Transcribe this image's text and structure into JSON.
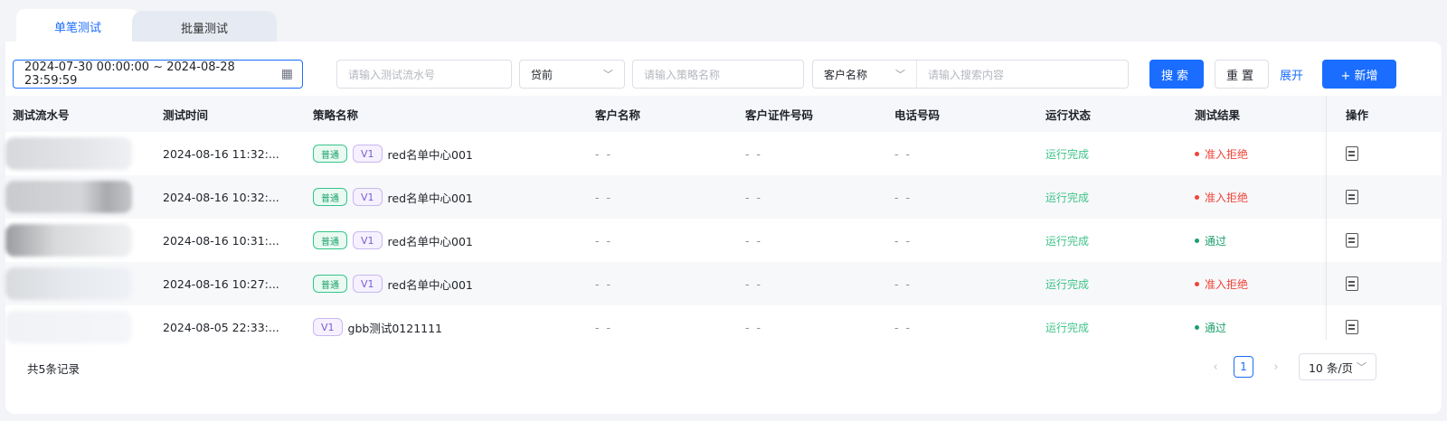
{
  "tabs": [
    {
      "label": "单笔测试",
      "active": true
    },
    {
      "label": "批量测试",
      "active": false
    }
  ],
  "filters": {
    "date_range": "2024-07-30 00:00:00 ~ 2024-08-28 23:59:59",
    "serial_placeholder": "请输入测试流水号",
    "loan_stage": "贷前",
    "strategy_placeholder": "请输入策略名称",
    "search_field": "客户名称",
    "search_placeholder": "请输入搜索内容"
  },
  "buttons": {
    "search": "搜索",
    "reset": "重置",
    "expand": "展开",
    "add": "+ 新增"
  },
  "table": {
    "headers": [
      "测试流水号",
      "测试时间",
      "策略名称",
      "客户名称",
      "客户证件号码",
      "电话号码",
      "运行状态",
      "测试结果",
      "操作"
    ],
    "rows": [
      {
        "time": "2024-08-16 11:32:...",
        "tag": "普通",
        "version": "V1",
        "strategy": "red名单中心001",
        "customer": "- -",
        "id_no": "- -",
        "phone": "- -",
        "status": "运行完成",
        "result": "准入拒绝",
        "result_color": "#f04438"
      },
      {
        "time": "2024-08-16 10:32:...",
        "tag": "普通",
        "version": "V1",
        "strategy": "red名单中心001",
        "customer": "- -",
        "id_no": "- -",
        "phone": "- -",
        "status": "运行完成",
        "result": "准入拒绝",
        "result_color": "#f04438"
      },
      {
        "time": "2024-08-16 10:31:...",
        "tag": "普通",
        "version": "V1",
        "strategy": "red名单中心001",
        "customer": "- -",
        "id_no": "- -",
        "phone": "- -",
        "status": "运行完成",
        "result": "通过",
        "result_color": "#1aa06a"
      },
      {
        "time": "2024-08-16 10:27:...",
        "tag": "普通",
        "version": "V1",
        "strategy": "red名单中心001",
        "customer": "- -",
        "id_no": "- -",
        "phone": "- -",
        "status": "运行完成",
        "result": "准入拒绝",
        "result_color": "#f04438"
      },
      {
        "time": "2024-08-05 22:33:...",
        "tag": "",
        "version": "V1",
        "strategy": "gbb测试0121111",
        "customer": "- -",
        "id_no": "- -",
        "phone": "- -",
        "status": "运行完成",
        "result": "通过",
        "result_color": "#1aa06a"
      }
    ]
  },
  "footer": {
    "total": "共5条记录",
    "current_page": "1",
    "page_size": "10 条/页"
  },
  "colors": {
    "primary": "#1a6dff",
    "success": "#3fc38a",
    "danger": "#f04438"
  }
}
